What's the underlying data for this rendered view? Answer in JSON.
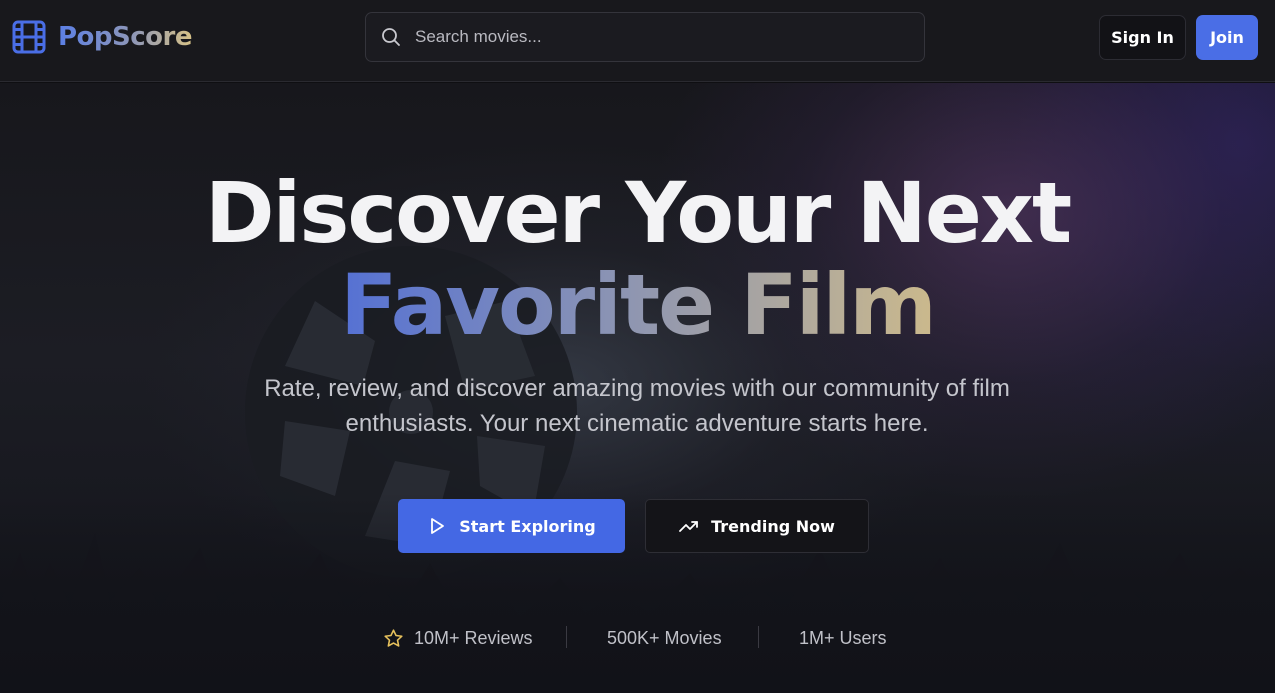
{
  "header": {
    "brand": "PopScore",
    "logo_icon": "film-icon",
    "search": {
      "placeholder": "Search movies...",
      "value": "",
      "icon": "search-icon"
    },
    "sign_in_label": "Sign In",
    "join_label": "Join"
  },
  "hero": {
    "headline": "Discover Your Next",
    "headline_accent": "Favorite Film",
    "subtitle": "Rate, review, and discover amazing movies with our community of film enthusiasts. Your next cinematic adventure starts here.",
    "primary_cta": {
      "label": "Start Exploring",
      "icon": "play-icon"
    },
    "secondary_cta": {
      "label": "Trending Now",
      "icon": "trending-up-icon"
    },
    "stats": [
      {
        "label": "10M+ Reviews",
        "icon": "star-icon"
      },
      {
        "label": "500K+ Movies"
      },
      {
        "label": "1M+ Users"
      }
    ]
  },
  "colors": {
    "accent": "#4a6ee6",
    "gold": "#e6c15c",
    "background": "#18181c"
  }
}
